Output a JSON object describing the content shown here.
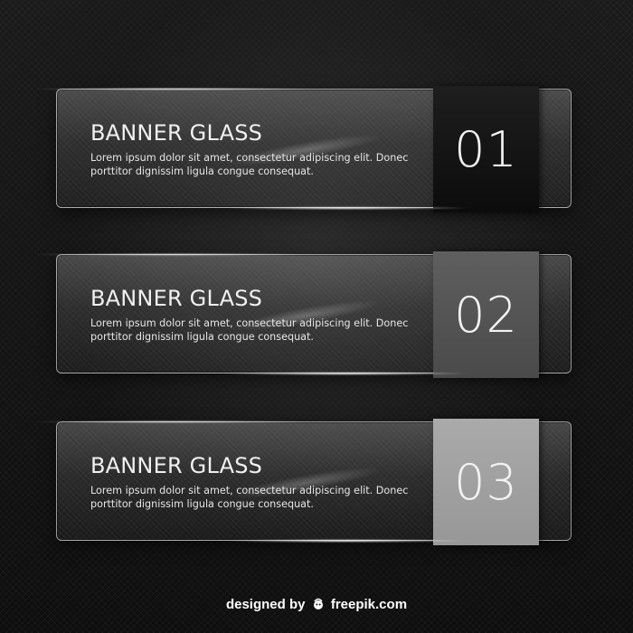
{
  "banners": [
    {
      "title": "BANNER GLASS",
      "text_line1": "Lorem ipsum dolor sit amet, consectetur adipiscing elit. Donec",
      "text_line2": "porttitor dignissim ligula congue consequat.",
      "number": "01",
      "tab_color": "#141414"
    },
    {
      "title": "BANNER GLASS",
      "text_line1": "Lorem ipsum dolor sit amet, consectetur adipiscing elit. Donec",
      "text_line2": "porttitor dignissim ligula congue consequat.",
      "number": "02",
      "tab_color": "#555555"
    },
    {
      "title": "BANNER GLASS",
      "text_line1": "Lorem ipsum dolor sit amet, consectetur adipiscing elit. Donec",
      "text_line2": "porttitor dignissim ligula congue consequat.",
      "number": "03",
      "tab_color": "#a0a0a0"
    }
  ],
  "footer": {
    "prefix": "designed by",
    "brand": "freepik.com",
    "icon": "freepik-logo-icon"
  }
}
